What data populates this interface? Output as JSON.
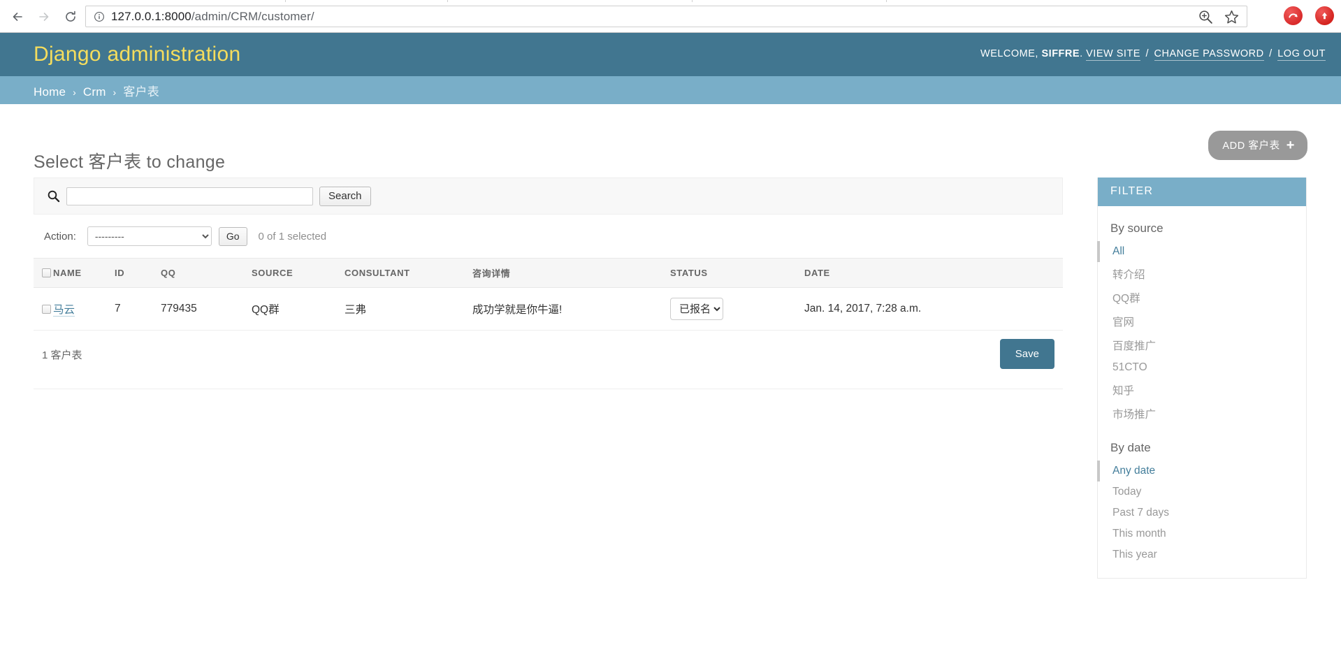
{
  "browser": {
    "back_icon": "arrow-left-icon",
    "forward_icon": "arrow-right-icon",
    "reload_icon": "reload-icon",
    "info_icon": "info-circle-icon",
    "url_host": "127.0.0.1:8000",
    "url_path": "/admin/CRM/customer/",
    "url_full": "127.0.0.1:8000/admin/CRM/customer/",
    "zoom_icon": "zoom-in-icon",
    "bookmark_icon": "star-icon",
    "extension_1": "red-circle-extension-icon",
    "extension_2": "red-circle-upload-extension-icon"
  },
  "header": {
    "branding": "Django administration",
    "welcome_prefix": "WELCOME,",
    "username": "SIFFRE",
    "username_suffix": ".",
    "view_site": "VIEW SITE",
    "change_password": "CHANGE PASSWORD",
    "log_out": "LOG OUT",
    "separator": "/",
    "bg_color": "#417690",
    "branding_color": "#f5dd5d"
  },
  "breadcrumbs": {
    "items": [
      {
        "label": "Home",
        "link": true
      },
      {
        "label": "Crm",
        "link": true
      },
      {
        "label": "客户表",
        "link": false
      }
    ],
    "arrow": "›",
    "bg_color": "#79aec8"
  },
  "page": {
    "title": "Select 客户表 to change",
    "add_button_label": "ADD 客户表",
    "add_button_plus": "+"
  },
  "search": {
    "icon": "search-icon",
    "value": "",
    "placeholder": "",
    "submit_label": "Search"
  },
  "actions": {
    "label": "Action:",
    "selected_option": "---------",
    "options": [
      "---------"
    ],
    "go_label": "Go",
    "counter": "0 of 1 selected"
  },
  "table": {
    "columns": [
      "NAME",
      "ID",
      "QQ",
      "SOURCE",
      "CONSULTANT",
      "咨询详情",
      "STATUS",
      "DATE"
    ],
    "rows": [
      {
        "checked": false,
        "name": "马云",
        "id": "7",
        "qq": "779435",
        "source": "QQ群",
        "consultant": "三弗",
        "detail": "成功学就是你牛逼!",
        "status": "已报名",
        "status_options": [
          "已报名"
        ],
        "date": "Jan. 14, 2017, 7:28 a.m."
      }
    ]
  },
  "footer": {
    "result_count": "1 客户表",
    "save_label": "Save",
    "save_color": "#417690"
  },
  "filter": {
    "title": "FILTER",
    "groups": [
      {
        "title": "By source",
        "items": [
          {
            "label": "All",
            "selected": true
          },
          {
            "label": "转介绍",
            "selected": false
          },
          {
            "label": "QQ群",
            "selected": false
          },
          {
            "label": "官网",
            "selected": false
          },
          {
            "label": "百度推广",
            "selected": false
          },
          {
            "label": "51CTO",
            "selected": false
          },
          {
            "label": "知乎",
            "selected": false
          },
          {
            "label": "市场推广",
            "selected": false
          }
        ]
      },
      {
        "title": "By date",
        "items": [
          {
            "label": "Any date",
            "selected": true
          },
          {
            "label": "Today",
            "selected": false
          },
          {
            "label": "Past 7 days",
            "selected": false
          },
          {
            "label": "This month",
            "selected": false
          },
          {
            "label": "This year",
            "selected": false
          }
        ]
      }
    ]
  }
}
